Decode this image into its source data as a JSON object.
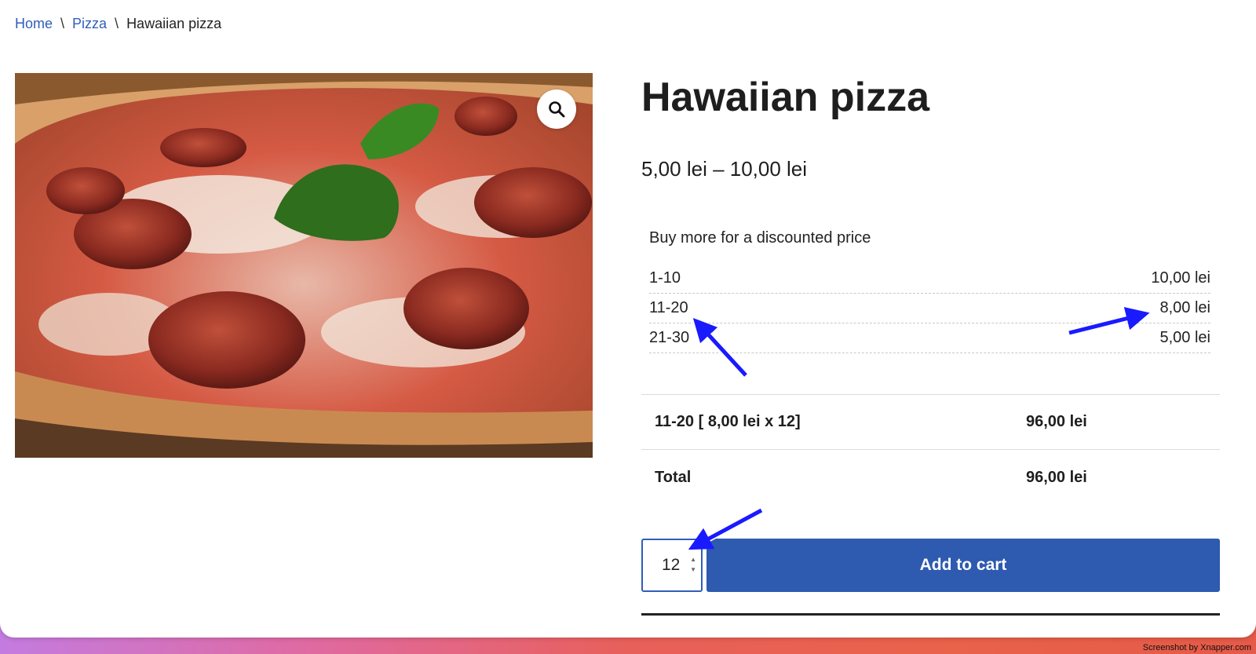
{
  "breadcrumb": {
    "home": "Home",
    "category": "Pizza",
    "current": "Hawaiian pizza",
    "separator": "\\"
  },
  "product": {
    "title": "Hawaiian pizza",
    "price_range": "5,00 lei – 10,00 lei",
    "image_icon": "zoom-icon"
  },
  "discount": {
    "heading": "Buy more for a discounted price",
    "tiers": [
      {
        "range": "1-10",
        "price": "10,00 lei"
      },
      {
        "range": "11-20",
        "price": "8,00 lei"
      },
      {
        "range": "21-30",
        "price": "5,00 lei"
      }
    ]
  },
  "calculation": {
    "line_label": "11-20 [ 8,00 lei x 12]",
    "line_value": "96,00 lei",
    "total_label": "Total",
    "total_value": "96,00 lei"
  },
  "cart": {
    "quantity": "12",
    "add_label": "Add to cart",
    "button_color": "#2e5ab0"
  },
  "annotation_color": "#1a1aff",
  "watermark": "Screenshot by Xnapper.com"
}
